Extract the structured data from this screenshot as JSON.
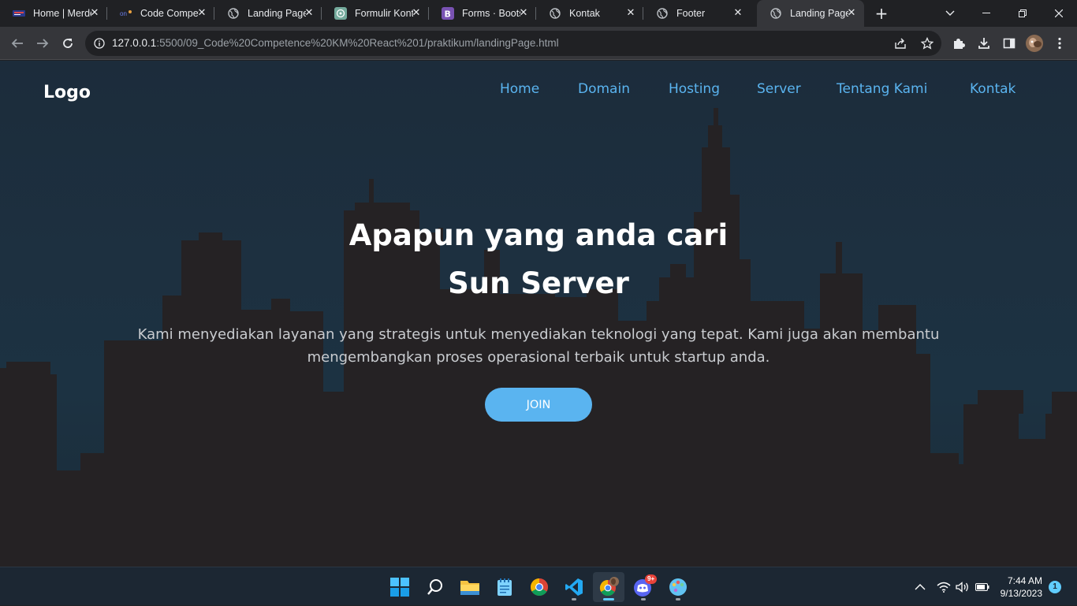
{
  "browser": {
    "tabs": [
      {
        "title": "Home | Merdeka",
        "icon": "merdeka-favicon-icon"
      },
      {
        "title": "Code Competence",
        "icon": "code-favicon-icon"
      },
      {
        "title": "Landing Page",
        "icon": "globe-icon"
      },
      {
        "title": "Formulir Kontak",
        "icon": "chatgpt-icon"
      },
      {
        "title": "Forms · Bootstrap",
        "icon": "bootstrap-icon"
      },
      {
        "title": "Kontak",
        "icon": "globe-icon"
      },
      {
        "title": "Footer",
        "icon": "globe-icon"
      },
      {
        "title": "Landing Page",
        "icon": "globe-icon",
        "active": true
      }
    ],
    "url_host": "127.0.0.1",
    "url_path": ":5500/09_Code%20Competence%20KM%20React%201/praktikum/landingPage.html"
  },
  "site": {
    "logo": "Logo",
    "nav": [
      "Home",
      "Domain",
      "Hosting",
      "Server",
      "Tentang Kami",
      "Kontak"
    ],
    "hero_line1": "Apapun yang anda cari",
    "hero_line2": "Sun Server",
    "hero_desc_line1": "Kami menyediakan layanan yang strategis untuk menyediakan teknologi yang tepat. Kami juga akan membantu",
    "hero_desc_line2": "mengembangkan proses operasional terbaik untuk startup anda.",
    "join_label": "JOIN",
    "colors": {
      "accent": "#5ab4f0",
      "background": "#1d3040",
      "skyline": "#252224"
    }
  },
  "taskbar": {
    "time": "7:44 AM",
    "date": "9/13/2023",
    "notifications": "1",
    "discord_badge": "9+"
  }
}
